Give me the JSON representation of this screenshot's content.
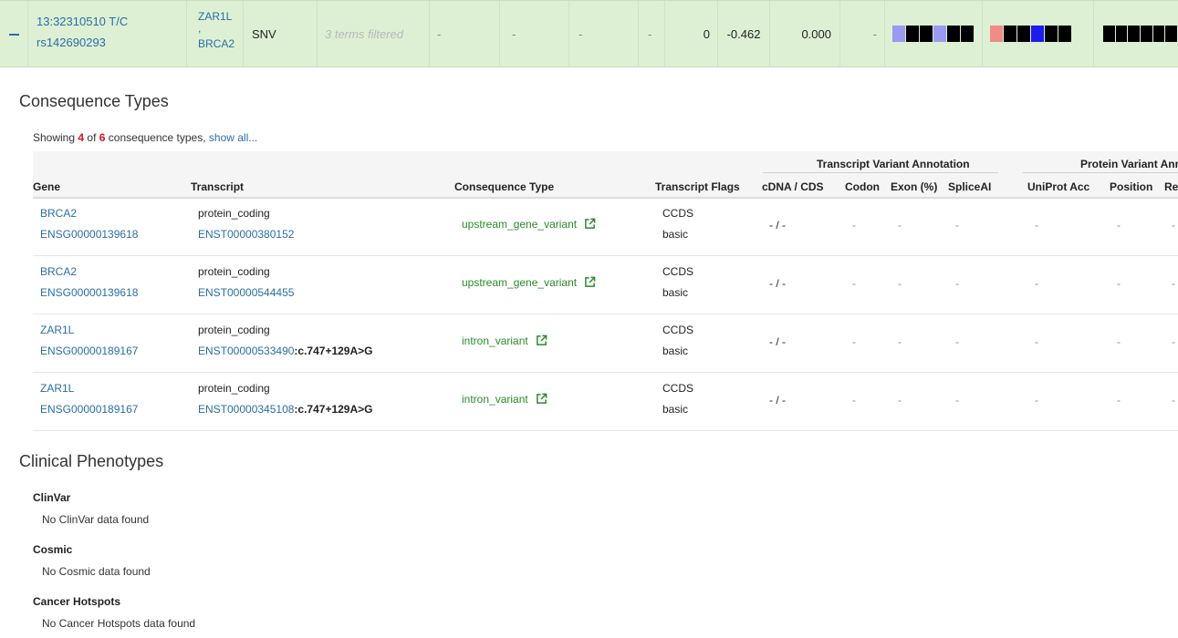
{
  "variant": {
    "id": "13:32310510 T/C",
    "rsid": "rs142690293",
    "genes": [
      "ZAR1L",
      ",",
      "BRCA2"
    ],
    "type": "SNV",
    "filter_text": "3 terms filtered",
    "dashes": [
      "-",
      "-",
      "-",
      "-"
    ],
    "count": "0",
    "score1": "-0.462",
    "score2": "0.000",
    "dash_last": "-",
    "block_groups": [
      [
        "blue-light",
        "black",
        "black",
        "blue-light",
        "black",
        "black"
      ],
      [
        "salmon",
        "black",
        "black",
        "blue",
        "black",
        "black"
      ],
      [
        "black",
        "black",
        "black",
        "black",
        "black",
        "black"
      ]
    ]
  },
  "consequence_section": {
    "title": "Consequence Types",
    "showing_prefix": "Showing",
    "showing_count": "4",
    "of_text": "of",
    "total_count": "6",
    "suffix": "consequence types,",
    "show_all": "show all..."
  },
  "table": {
    "group_headers": {
      "transcript_variant": "Transcript Variant Annotation",
      "protein_variant": "Protein Variant Ann"
    },
    "columns": {
      "gene": "Gene",
      "transcript": "Transcript",
      "consequence": "Consequence Type",
      "flags": "Transcript Flags",
      "cdna": "cDNA / CDS",
      "codon": "Codon",
      "exon": "Exon (%)",
      "spliceai": "SpliceAI",
      "uniprot": "UniProt Acc",
      "position": "Position",
      "ref": "Re"
    },
    "rows": [
      {
        "gene": "BRCA2",
        "gene_id": "ENSG00000139618",
        "biotype": "protein_coding",
        "transcript": "ENST00000380152",
        "hgvs": "",
        "consequence": "upstream_gene_variant",
        "flag1": "CCDS",
        "flag2": "basic",
        "cdna": "- / -",
        "codon": "-",
        "exon": "-",
        "spliceai": "-",
        "uniprot": "-",
        "position": "-",
        "ref": "-"
      },
      {
        "gene": "BRCA2",
        "gene_id": "ENSG00000139618",
        "biotype": "protein_coding",
        "transcript": "ENST00000544455",
        "hgvs": "",
        "consequence": "upstream_gene_variant",
        "flag1": "CCDS",
        "flag2": "basic",
        "cdna": "- / -",
        "codon": "-",
        "exon": "-",
        "spliceai": "-",
        "uniprot": "-",
        "position": "-",
        "ref": "-"
      },
      {
        "gene": "ZAR1L",
        "gene_id": "ENSG00000189167",
        "biotype": "protein_coding",
        "transcript": "ENST00000533490",
        "hgvs": ":c.747+129A>G",
        "consequence": "intron_variant",
        "flag1": "CCDS",
        "flag2": "basic",
        "cdna": "- / -",
        "codon": "-",
        "exon": "-",
        "spliceai": "-",
        "uniprot": "-",
        "position": "-",
        "ref": "-"
      },
      {
        "gene": "ZAR1L",
        "gene_id": "ENSG00000189167",
        "biotype": "protein_coding",
        "transcript": "ENST00000345108",
        "hgvs": ":c.747+129A>G",
        "consequence": "intron_variant",
        "flag1": "CCDS",
        "flag2": "basic",
        "cdna": "- / -",
        "codon": "-",
        "exon": "-",
        "spliceai": "-",
        "uniprot": "-",
        "position": "-",
        "ref": "-"
      }
    ]
  },
  "clinical": {
    "title": "Clinical Phenotypes",
    "items": [
      {
        "heading": "ClinVar",
        "text": "No ClinVar data found"
      },
      {
        "heading": "Cosmic",
        "text": "No Cosmic data found"
      },
      {
        "heading": "Cancer Hotspots",
        "text": "No Cancer Hotspots data found"
      }
    ]
  }
}
